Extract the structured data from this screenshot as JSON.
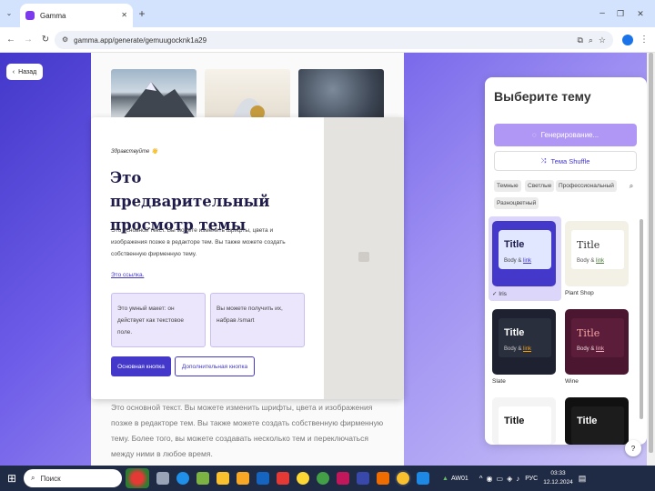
{
  "browser": {
    "tab_title": "Gamma",
    "url": "gamma.app/generate/gemuugocknk1a29",
    "icons": [
      "tab-search-icon",
      "new-tab-icon",
      "minimize-icon",
      "maximize-icon",
      "close-icon",
      "back-icon",
      "forward-icon",
      "reload-icon",
      "site-info-icon",
      "install-icon",
      "zoom-icon",
      "bookmark-star-icon",
      "profile-icon",
      "menu-icon"
    ]
  },
  "page": {
    "back_label": "Назад",
    "preview": {
      "greeting": "Здравствуйте 👋",
      "heading": "Это предварительный просмотр темы",
      "body": "Это основной текст. Вы можете изменить шрифты, цвета и изображения позже в редакторе тем. Вы также можете создать собственную фирменную тему.",
      "link": "Это ссылка.",
      "callout1": "Это умный макет: он действует как текстовое поле.",
      "callout2": "Вы можете получить их, набрав /smart",
      "primary_button": "Основная кнопка",
      "secondary_button": "Дополнительная кнопка"
    },
    "below_text": "Это основной текст. Вы можете изменить шрифты, цвета и изображения позже в редакторе тем. Вы также можете создать собственную фирменную тему. Более того, вы можете создавать несколько тем и переключаться между ними в любое время."
  },
  "panel": {
    "title": "Выберите тему",
    "generating_label": "Генерирование...",
    "shuffle_label": "Тема Shuffle",
    "filters": [
      "Темные",
      "Светлые",
      "Профессиональный",
      "Разноцветный"
    ],
    "themes": [
      {
        "name": "Iris",
        "title": "Title",
        "body": "Body &",
        "link": "link",
        "selected": true,
        "bg": "#4338ca",
        "card": "#e0e7ff",
        "title_color": "#1e1b4b",
        "body_color": "#444444",
        "link_color": "#4338ca"
      },
      {
        "name": "Plant Shop",
        "title": "Title",
        "body": "Body &",
        "link": "link",
        "selected": false,
        "bg": "#f3f1e6",
        "card": "#ffffff",
        "title_color": "#333333",
        "body_color": "#555555",
        "link_color": "#4b7a3a"
      },
      {
        "name": "Slate",
        "title": "Title",
        "body": "Body &",
        "link": "link",
        "selected": false,
        "bg": "#1e2230",
        "card": "#2a2f3e",
        "title_color": "#ffffff",
        "body_color": "#cccccc",
        "link_color": "#f59e0b"
      },
      {
        "name": "Wine",
        "title": "Title",
        "body": "Body &",
        "link": "link",
        "selected": false,
        "bg": "#4a1630",
        "card": "#5c1d3b",
        "title_color": "#f4a3a3",
        "body_color": "#f0dede",
        "link_color": "#f6b3c0"
      },
      {
        "name": "",
        "title": "Title",
        "body": "",
        "link": "",
        "selected": false,
        "bg": "#f4f4f4",
        "card": "#ffffff",
        "title_color": "#111111",
        "body_color": "#444444",
        "link_color": "#444444"
      },
      {
        "name": "",
        "title": "Title",
        "body": "",
        "link": "",
        "selected": false,
        "bg": "#111111",
        "card": "#1c1c1c",
        "title_color": "#ffffff",
        "body_color": "#cccccc",
        "link_color": "#cccccc"
      }
    ],
    "help_label": "?"
  },
  "taskbar": {
    "search_label": "Поиск",
    "weather": "AW01",
    "lang": "РУС",
    "time": "03:33",
    "date": "12.12.2024"
  }
}
